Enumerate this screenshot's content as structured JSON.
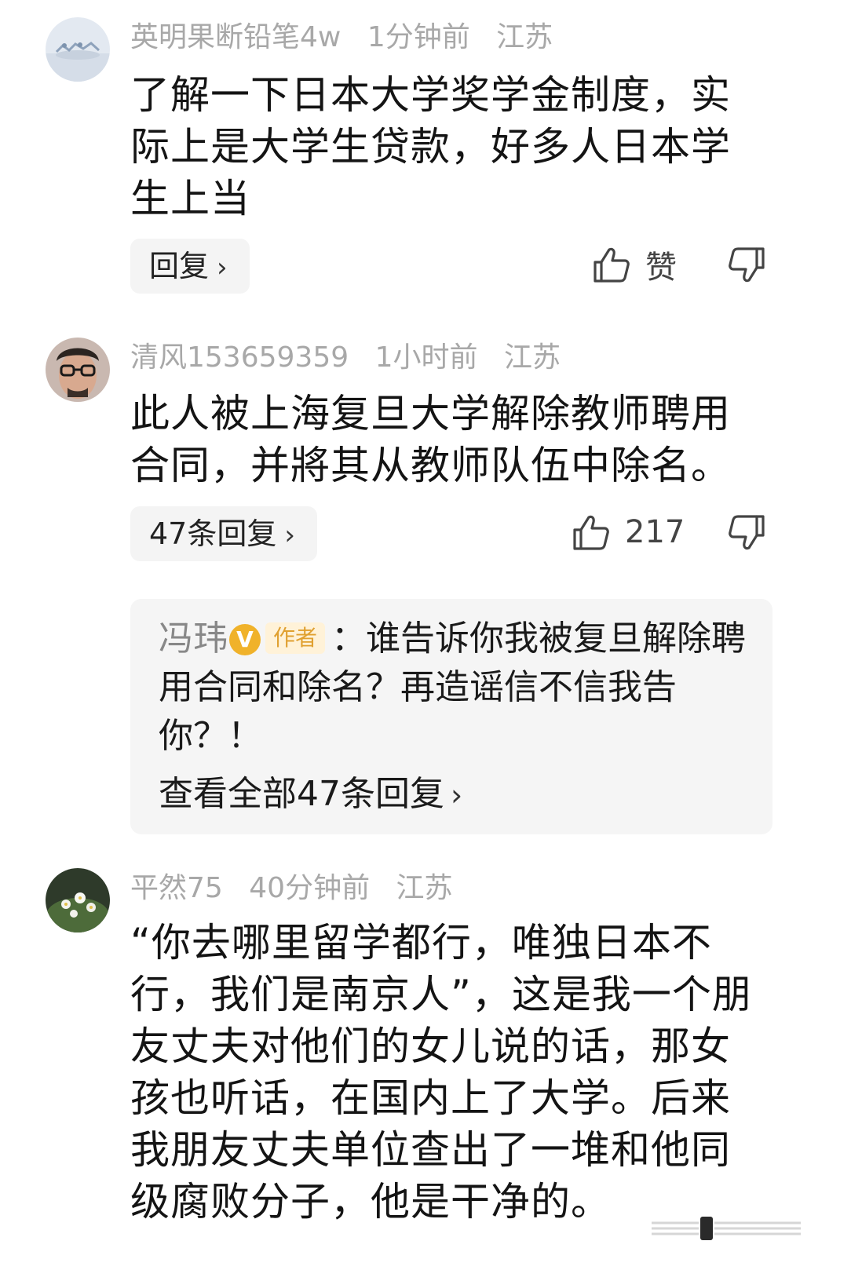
{
  "comments": [
    {
      "avatar": "landscape-avatar",
      "username": "英明果断铅笔4w",
      "time": "1分钟前",
      "location": "江苏",
      "text": "了解一下日本大学奖学金制度，实际上是大学生贷款，好多人日本学生上当",
      "reply_label": "回复",
      "like_label": "赞"
    },
    {
      "avatar": "man-glasses-avatar",
      "username": "清风153659359",
      "time": "1小时前",
      "location": "江苏",
      "text": "此人被上海复旦大学解除教师聘用合同，并將其从教师队伍中除名。",
      "reply_label": "47条回复",
      "like_count": "217",
      "sub_reply": {
        "author": "冯玮",
        "verified_mark": "V",
        "author_badge": "作者",
        "text": "：谁告诉你我被复旦解除聘用合同和除名？再造谣信不信我告你？！",
        "view_all": "查看全部47条回复"
      }
    },
    {
      "avatar": "flowers-avatar",
      "username": "平然75",
      "time": "40分钟前",
      "location": "江苏",
      "text": "“你去哪里留学都行，唯独日本不行，我们是南京人”，这是我一个朋友丈夫对他们的女儿说的话，那女孩也听话，在国内上了大学。后来我朋友丈夫单位查出了一堆和他同级腐败分子，他是干净的。"
    }
  ],
  "icons": {
    "like": "thumbs-up-icon",
    "dislike": "thumbs-down-icon",
    "chevron": "chevron-right-icon"
  },
  "colors": {
    "meta": "#a8a8a8",
    "verified": "#f0b22a",
    "author_badge_bg": "#fff2d8",
    "sub_box_bg": "#f5f5f5"
  }
}
